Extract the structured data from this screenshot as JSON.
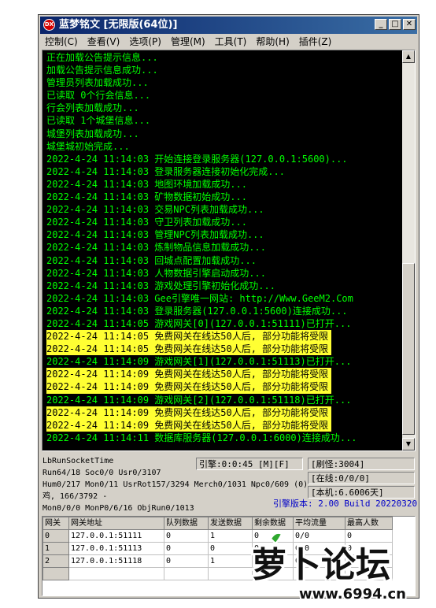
{
  "window": {
    "app_icon": "DX",
    "title": "蓝梦铭文 [无限版(64位)]",
    "controls": [
      "_",
      "□",
      "✕"
    ]
  },
  "menu": [
    "控制(C)",
    "查看(V)",
    "选项(P)",
    "管理(M)",
    "工具(T)",
    "帮助(H)",
    "插件(Z)"
  ],
  "log": [
    {
      "text": "正在加载公告提示信息...",
      "hl": false
    },
    {
      "text": "加载公告提示信息成功...",
      "hl": false
    },
    {
      "text": "管理员列表加载成功...",
      "hl": false
    },
    {
      "text": "已读取 0个行会信息...",
      "hl": false
    },
    {
      "text": "行会列表加载成功...",
      "hl": false
    },
    {
      "text": "已读取 1个城堡信息...",
      "hl": false
    },
    {
      "text": "城堡列表加载成功...",
      "hl": false
    },
    {
      "text": "城堡城初始完成...",
      "hl": false
    },
    {
      "text": "2022-4-24 11:14:03 开始连接登录服务器(127.0.0.1:5600)...",
      "hl": false
    },
    {
      "text": "2022-4-24 11:14:03 登录服务器连接初始化完成...",
      "hl": false
    },
    {
      "text": "2022-4-24 11:14:03 地图环境加载成功...",
      "hl": false
    },
    {
      "text": "2022-4-24 11:14:03 矿物数据初始成功...",
      "hl": false
    },
    {
      "text": "2022-4-24 11:14:03 交易NPC列表加载成功...",
      "hl": false
    },
    {
      "text": "2022-4-24 11:14:03 守卫列表加载成功...",
      "hl": false
    },
    {
      "text": "2022-4-24 11:14:03 管理NPC列表加载成功...",
      "hl": false
    },
    {
      "text": "2022-4-24 11:14:03 炼制物品信息加载成功...",
      "hl": false
    },
    {
      "text": "2022-4-24 11:14:03 回城点配置加载成功...",
      "hl": false
    },
    {
      "text": "2022-4-24 11:14:03 人物数据引擎启动成功...",
      "hl": false
    },
    {
      "text": "2022-4-24 11:14:03 游戏处理引擎初始化成功...",
      "hl": false
    },
    {
      "text": "2022-4-24 11:14:03 Gee引擎唯一网站: http://Www.GeeM2.Com",
      "hl": false
    },
    {
      "text": "2022-4-24 11:14:03 登录服务器(127.0.0.1:5600)连接成功...",
      "hl": false
    },
    {
      "text": "2022-4-24 11:14:05 游戏网关[0](127.0.0.1:51111)已打开...",
      "hl": false
    },
    {
      "text": "2022-4-24 11:14:05 免费网关在线达50人后, 部分功能将受限",
      "hl": true
    },
    {
      "text": "2022-4-24 11:14:05 免费网关在线达50人后, 部分功能将受限",
      "hl": true
    },
    {
      "text": "2022-4-24 11:14:09 游戏网关[1](127.0.0.1:51113)已打开...",
      "hl": false
    },
    {
      "text": "2022-4-24 11:14:09 免费网关在线达50人后, 部分功能将受限",
      "hl": true
    },
    {
      "text": "2022-4-24 11:14:09 免费网关在线达50人后, 部分功能将受限",
      "hl": true
    },
    {
      "text": "2022-4-24 11:14:09 游戏网关[2](127.0.0.1:51118)已打开...",
      "hl": false
    },
    {
      "text": "2022-4-24 11:14:09 免费网关在线达50人后, 部分功能将受限",
      "hl": true
    },
    {
      "text": "2022-4-24 11:14:09 免费网关在线达50人后, 部分功能将受限",
      "hl": true
    },
    {
      "text": "2022-4-24 11:14:11 数据库服务器(127.0.0.1:6000)连接成功...",
      "hl": false
    }
  ],
  "status": {
    "line1": "LbRunSocketTime",
    "line2": "Run64/18 Soc0/0 Usr0/3107",
    "line3": "Hum0/217 Mon0/11 UsrRot157/3294 Merch0/1031 Npc0/609 (0)",
    "line4": "鸡, 166/3792 -",
    "line5": "Mon0/0/0 MonP0/6/16 ObjRun0/1013",
    "engine": "引擎:0:0:45 [M][F]",
    "refresh": "[刷怪:3004]",
    "online": "[在线:0/0/0]",
    "local": "[本机:6.6006天]",
    "version": "引擎版本: 2.00 Build 20220320"
  },
  "grid": {
    "columns": [
      "网关",
      "网关地址",
      "队列数据",
      "发送数据",
      "剩余数据",
      "平均流量",
      "最高人数"
    ],
    "rows": [
      [
        "0",
        "127.0.0.1:51111",
        "0",
        "1",
        "0",
        "0/0",
        "0"
      ],
      [
        "1",
        "127.0.0.1:51113",
        "0",
        "0",
        "0",
        "0/0",
        "0"
      ],
      [
        "2",
        "127.0.0.1:51118",
        "0",
        "1",
        "0",
        "0/0",
        "0"
      ]
    ]
  },
  "watermark": {
    "text": "萝卜论坛",
    "url": "www.6994.cn"
  }
}
